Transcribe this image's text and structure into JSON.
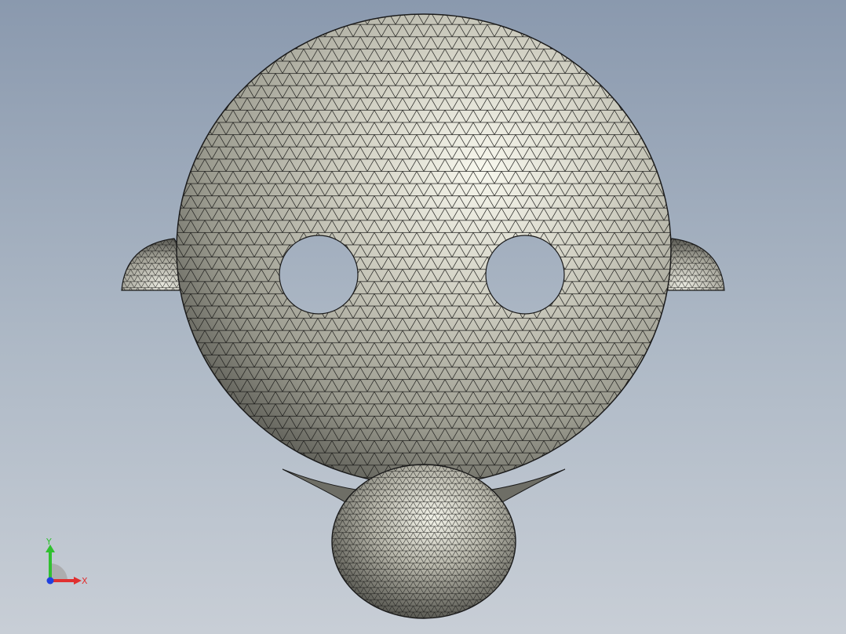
{
  "viewport": {
    "colors": {
      "background_top": "#8a99ae",
      "background_bottom": "#c8ced6",
      "model_highlight": "#f6f6ec",
      "model_mid": "#a9a89b",
      "model_shadow": "#4a4a45",
      "mesh_line": "#1a1a1a"
    }
  },
  "triad": {
    "x_label": "X",
    "y_label": "Y",
    "x_color": "#e03030",
    "y_color": "#30c030",
    "z_color": "#2040e0"
  }
}
